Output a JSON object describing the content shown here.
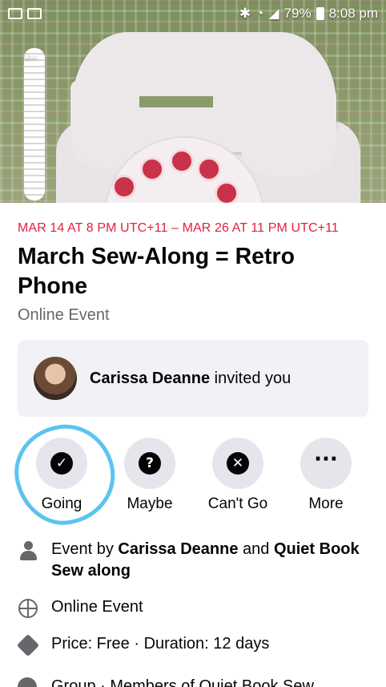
{
  "status_bar": {
    "battery": "79%",
    "time": "8:08 pm"
  },
  "event": {
    "date_range": "MAR 14 AT 8 PM UTC+11 – MAR 26 AT 11 PM UTC+11",
    "title": "March Sew-Along = Retro Phone",
    "type": "Online Event"
  },
  "invite": {
    "inviter": "Carissa Deanne",
    "message": " invited you"
  },
  "actions": [
    {
      "label": "Going",
      "icon": "check-icon"
    },
    {
      "label": "Maybe",
      "icon": "question-icon"
    },
    {
      "label": "Can't Go",
      "icon": "x-icon"
    },
    {
      "label": "More",
      "icon": "more-icon"
    }
  ],
  "details": {
    "host_prefix": "Event by ",
    "host1": "Carissa Deanne",
    "host_join": " and ",
    "host2": "Quiet Book Sew along",
    "location": "Online Event",
    "price": "Price: Free · Duration: 12 days",
    "group": "Group · Members of Quiet Book Sew"
  },
  "colors": {
    "date_red": "#e41e3f",
    "annotation_blue": "#5cc3f0",
    "card_bg": "#f0f2f5",
    "button_bg": "#e4e6eb"
  }
}
